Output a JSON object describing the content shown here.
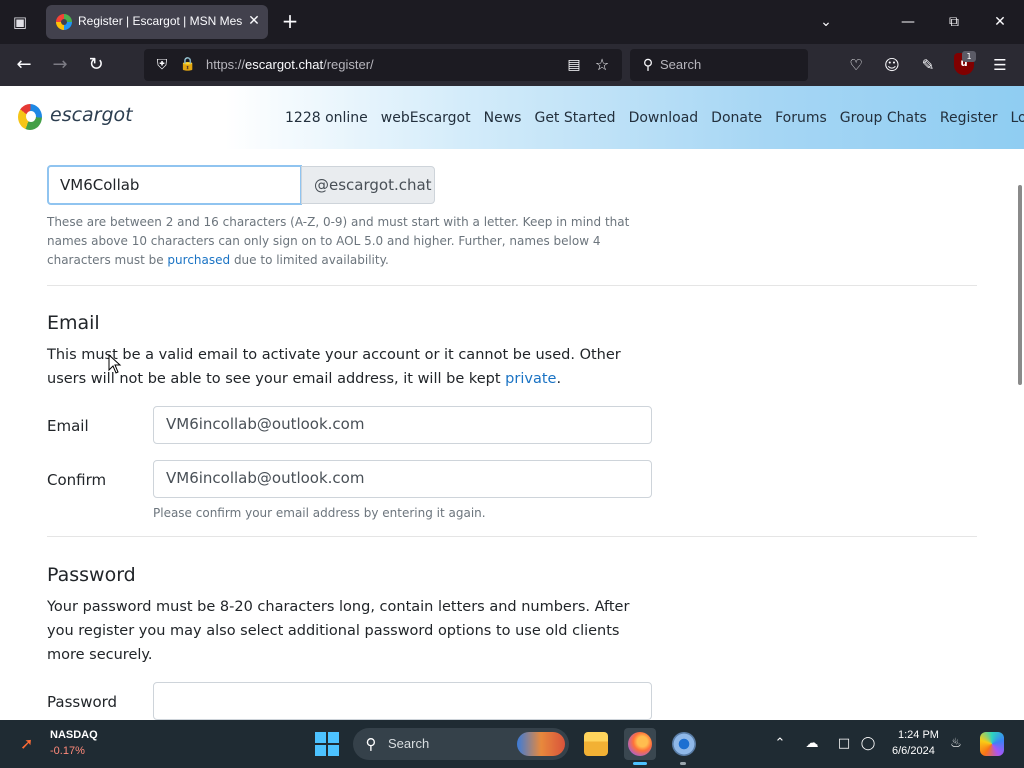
{
  "browser": {
    "tab": {
      "title": "Register | Escargot | MSN Messenger"
    },
    "url": {
      "scheme": "https://",
      "host": "escargot.chat",
      "path": "/register/"
    },
    "search": {
      "placeholder": "Search"
    },
    "ublock_badge": "1",
    "icons": [
      "tab-list-icon",
      "close-icon",
      "plus-icon",
      "chevron-down-icon",
      "minimize-icon",
      "restore-icon",
      "back-icon",
      "forward-icon",
      "reload-icon",
      "shield-icon",
      "lock-icon",
      "reader-icon",
      "star-icon",
      "search-icon",
      "pocket-icon",
      "account-icon",
      "extensions-icon",
      "ublock-icon",
      "menu-icon"
    ]
  },
  "site": {
    "logo": "escargot",
    "nav": [
      "1228 online",
      "webEscargot",
      "News",
      "Get Started",
      "Download",
      "Donate",
      "Forums",
      "Group Chats",
      "Register",
      "Log in"
    ]
  },
  "form": {
    "username": {
      "value": "VM6Collab",
      "suffix": "@escargot.chat",
      "help_before": "These are between 2 and 16 characters (A-Z, 0-9) and must start with a letter. Keep in mind that names above 10 characters can only sign on to AOL 5.0 and higher. Further, names below 4 characters must be ",
      "help_link": "purchased",
      "help_after": " due to limited availability."
    },
    "email": {
      "title": "Email",
      "desc_before": "This must be a valid email to activate your account or it cannot be used. Other users will not be able to see your email address, it will be kept ",
      "desc_link": "private",
      "desc_after": ".",
      "email_label": "Email",
      "email_value": "VM6incollab@outlook.com",
      "confirm_label": "Confirm",
      "confirm_value": "VM6incollab@outlook.com",
      "confirm_help": "Please confirm your email address by entering it again."
    },
    "password": {
      "title": "Password",
      "desc": "Your password must be 8-20 characters long, contain letters and numbers. After you register you may also select additional password options to use old clients more securely.",
      "password_label": "Password",
      "password_value": ""
    }
  },
  "taskbar": {
    "stock_name": "NASDAQ",
    "stock_change": "-0.17%",
    "search_label": "Search",
    "time": "1:24 PM",
    "date": "6/6/2024"
  },
  "colors": {
    "link": "#1a73c4",
    "focus_border": "#90c4f0",
    "stock_down": "#ff8a7a"
  }
}
